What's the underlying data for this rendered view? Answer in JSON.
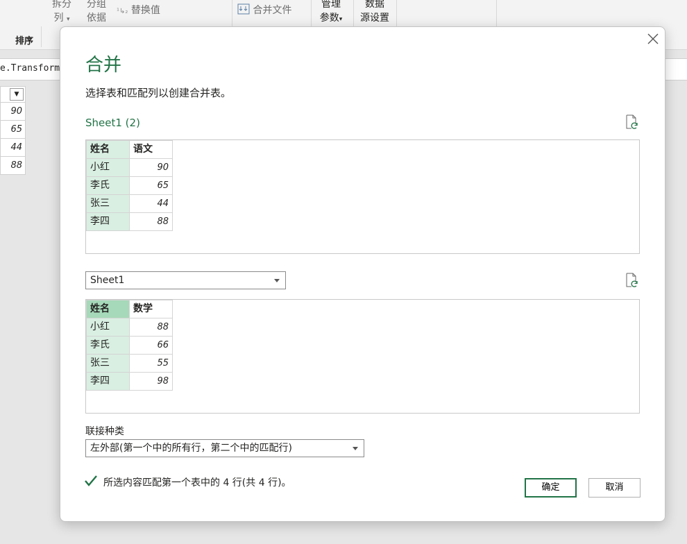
{
  "ribbon": {
    "split_column": {
      "line1": "拆分",
      "line2": "列"
    },
    "group_by": {
      "line1": "分组",
      "line2": "依据"
    },
    "replace_values": "替换值",
    "combine_files": "合并文件",
    "manage_params": {
      "line1": "管理",
      "line2": "参数"
    },
    "data_source": {
      "line1": "数据",
      "line2": "源设置"
    },
    "sort_group": "排序"
  },
  "formula": {
    "text": "e.Transform"
  },
  "background_column": {
    "values": [
      "90",
      "65",
      "44",
      "88"
    ]
  },
  "dialog": {
    "title": "合并",
    "description": "选择表和匹配列以创建合并表。",
    "table1": {
      "label": "Sheet1 (2)",
      "headers": [
        "姓名",
        "语文"
      ],
      "rows": [
        [
          "小红",
          "90"
        ],
        [
          "李氏",
          "65"
        ],
        [
          "张三",
          "44"
        ],
        [
          "李四",
          "88"
        ]
      ]
    },
    "table2": {
      "selected": "Sheet1",
      "headers": [
        "姓名",
        "数学"
      ],
      "rows": [
        [
          "小红",
          "88"
        ],
        [
          "李氏",
          "66"
        ],
        [
          "张三",
          "55"
        ],
        [
          "李四",
          "98"
        ]
      ]
    },
    "join": {
      "label": "联接种类",
      "selected": "左外部(第一个中的所有行，第二个中的匹配行)"
    },
    "status": "所选内容匹配第一个表中的 4 行(共 4 行)。",
    "ok_label": "确定",
    "cancel_label": "取消"
  },
  "colors": {
    "accent": "#217346",
    "key_column": "#d9efe2",
    "selected_key": "#a6d9b9"
  }
}
